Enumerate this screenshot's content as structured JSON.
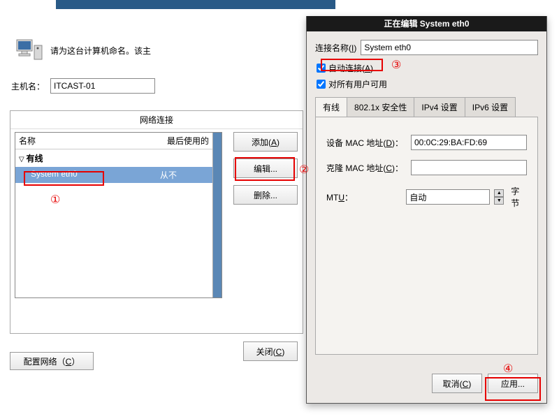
{
  "top_prompt": "请为这台计算机命名。该主",
  "hostname_label": "主机名：",
  "hostname_value": "ITCAST-01",
  "network_panel_title": "网络连接",
  "columns": {
    "name": "名称",
    "last": "最后使用的"
  },
  "category_wired": "有线",
  "items": [
    {
      "name": "System eth0",
      "last": "从不"
    }
  ],
  "buttons": {
    "add": "添加(A)",
    "edit": "编辑...",
    "delete": "删除...",
    "close": "关闭(C)",
    "config_network": "配置网络（C）"
  },
  "dialog": {
    "title": "正在编辑 System eth0",
    "conn_name_label": "连接名称(I)",
    "conn_name_value": "System eth0",
    "auto_connect_label": "自动连接(A)",
    "all_users_label": "对所有用户可用",
    "tabs": {
      "wired": "有线",
      "security": "802.1x 安全性",
      "ipv4": "IPv4 设置",
      "ipv6": "IPv6 设置"
    },
    "device_mac_label": "设备 MAC 地址(D)：",
    "device_mac_value": "00:0C:29:BA:FD:69",
    "cloned_mac_label": "克隆 MAC 地址(C)：",
    "cloned_mac_value": "",
    "mtu_label": "MTU：",
    "mtu_value": "自动",
    "mtu_unit": "字节",
    "cancel": "取消(C)",
    "apply": "应用..."
  },
  "annotations": {
    "n1": "①",
    "n2": "②",
    "n3": "③",
    "n4": "④"
  }
}
